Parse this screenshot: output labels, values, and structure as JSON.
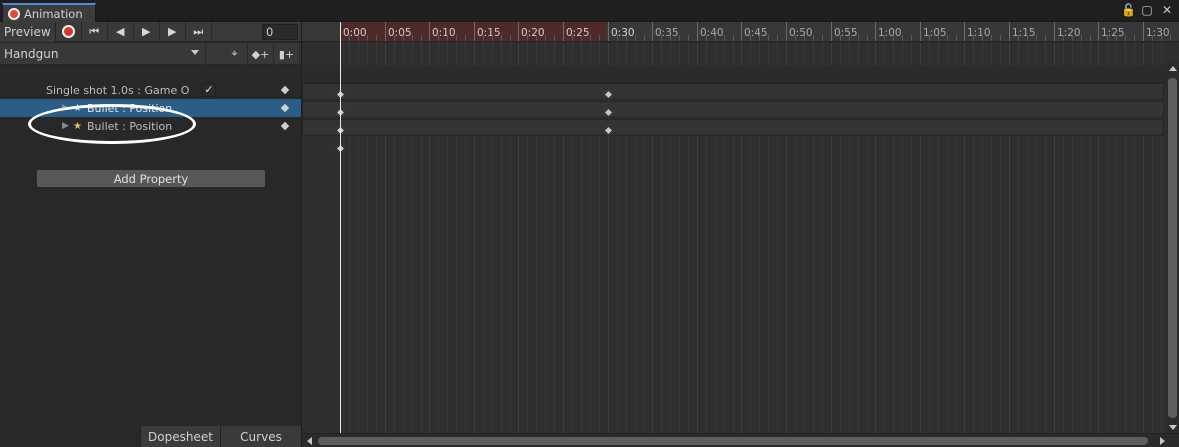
{
  "window": {
    "tab_title": "Animation",
    "controls": [
      "lock-icon",
      "maximize-icon",
      "close-icon"
    ]
  },
  "toolbar": {
    "preview_label": "Preview",
    "frame_value": "0"
  },
  "clip": {
    "name": "Handgun"
  },
  "properties": {
    "summary_label": "Single shot 1.0s : Game O",
    "items": [
      {
        "label": "Bullet : Position",
        "selected": true
      },
      {
        "label": "Bullet : Position",
        "selected": false
      }
    ]
  },
  "add_property_label": "Add Property",
  "bottom_tabs": {
    "dopesheet": "Dopesheet",
    "curves": "Curves"
  },
  "ruler": {
    "labels": [
      "0:00",
      "0:05",
      "0:10",
      "0:15",
      "0:20",
      "0:25",
      "0:30",
      "0:35",
      "0:40",
      "0:45",
      "0:50",
      "0:55",
      "1:00",
      "1:05",
      "1:10",
      "1:15",
      "1:20",
      "1:25",
      "1:30"
    ]
  },
  "colors": {
    "accent": "#2c5d87",
    "record": "#d43a2a",
    "clip_range": "#4e2a2a"
  }
}
